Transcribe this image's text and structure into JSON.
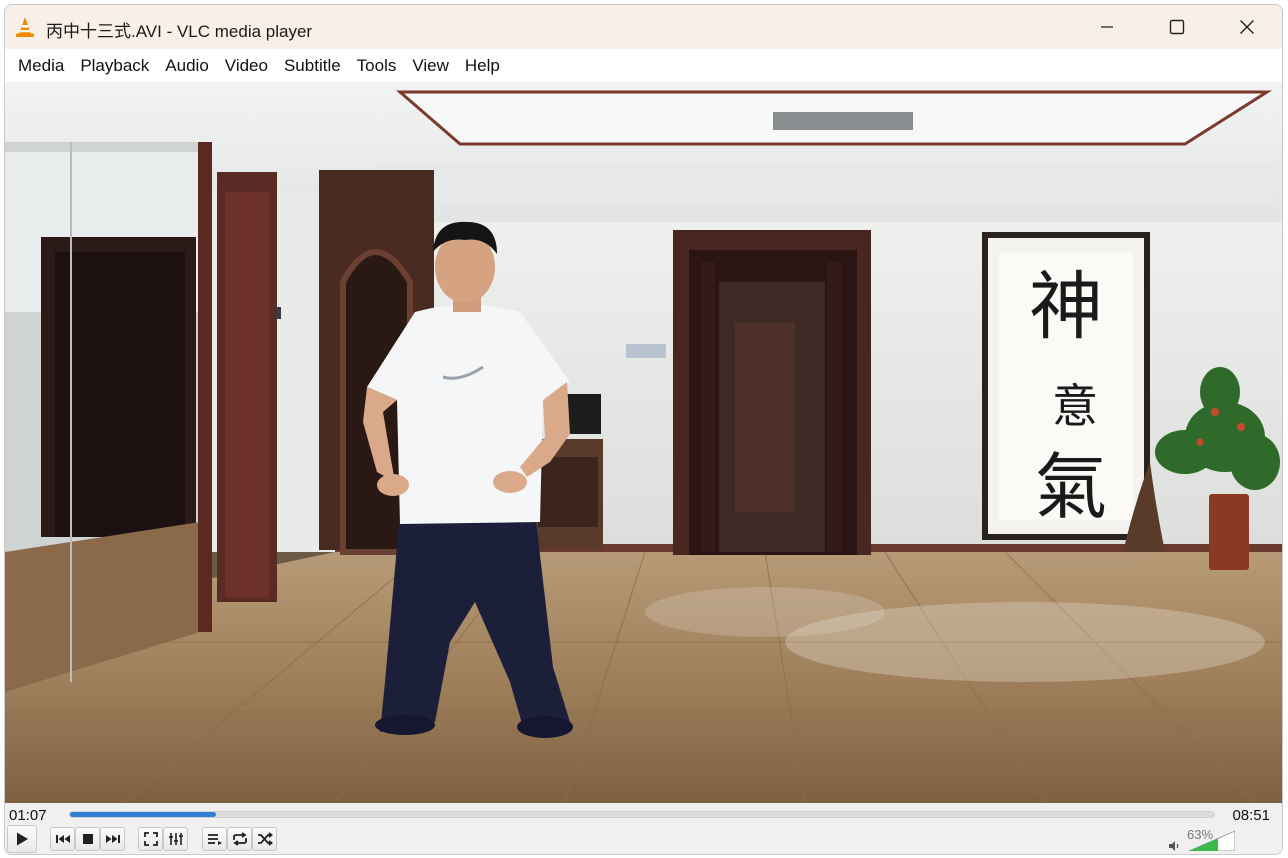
{
  "window": {
    "title": "丙中十三式.AVI - VLC media player"
  },
  "menu": {
    "items": [
      "Media",
      "Playback",
      "Audio",
      "Video",
      "Subtitle",
      "Tools",
      "View",
      "Help"
    ]
  },
  "video": {
    "calligraphy": [
      "神",
      "意",
      "氣"
    ]
  },
  "controls": {
    "elapsed": "01:07",
    "total": "08:51",
    "progress_fraction": 0.128,
    "volume_label": "63%",
    "volume_fraction": 0.63
  },
  "icons": {
    "app": "vlc-cone-icon",
    "minimize": "minimize-icon",
    "maximize": "maximize-icon",
    "close": "close-icon",
    "play": "play-icon",
    "prev": "previous-icon",
    "stop": "stop-icon",
    "next": "next-icon",
    "fullscreen": "fullscreen-icon",
    "extended": "extended-settings-icon",
    "playlist": "playlist-icon",
    "loop": "loop-icon",
    "shuffle": "shuffle-icon",
    "volume": "speaker-icon"
  },
  "colors": {
    "accent": "#2f7fd6",
    "titlebar": "#f9efe6",
    "volume_green": "#3cb94a"
  }
}
